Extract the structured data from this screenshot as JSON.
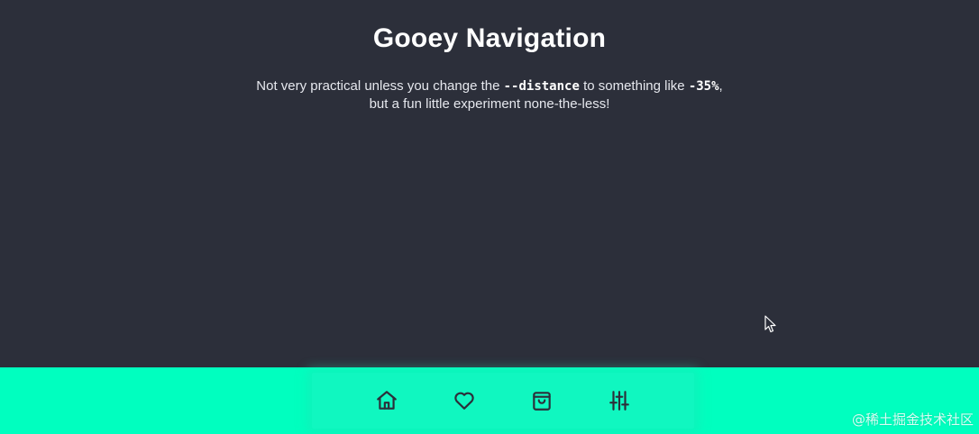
{
  "header": {
    "title": "Gooey Navigation"
  },
  "description": {
    "part1": "Not very practical unless you change the ",
    "code1": "--distance",
    "part2": " to something like ",
    "code2": "-35%",
    "part3": ",",
    "line2": "but a fun little experiment none-the-less!"
  },
  "nav": {
    "items": [
      {
        "icon": "home-icon"
      },
      {
        "icon": "heart-icon"
      },
      {
        "icon": "shopping-bag-icon"
      },
      {
        "icon": "sliders-icon"
      }
    ]
  },
  "watermark": {
    "text": "@稀土掘金技术社区"
  },
  "colors": {
    "background": "#2c2f3a",
    "nav_background": "#00ffbf",
    "icon_stroke": "#2c2f3a",
    "text": "#ffffff"
  }
}
